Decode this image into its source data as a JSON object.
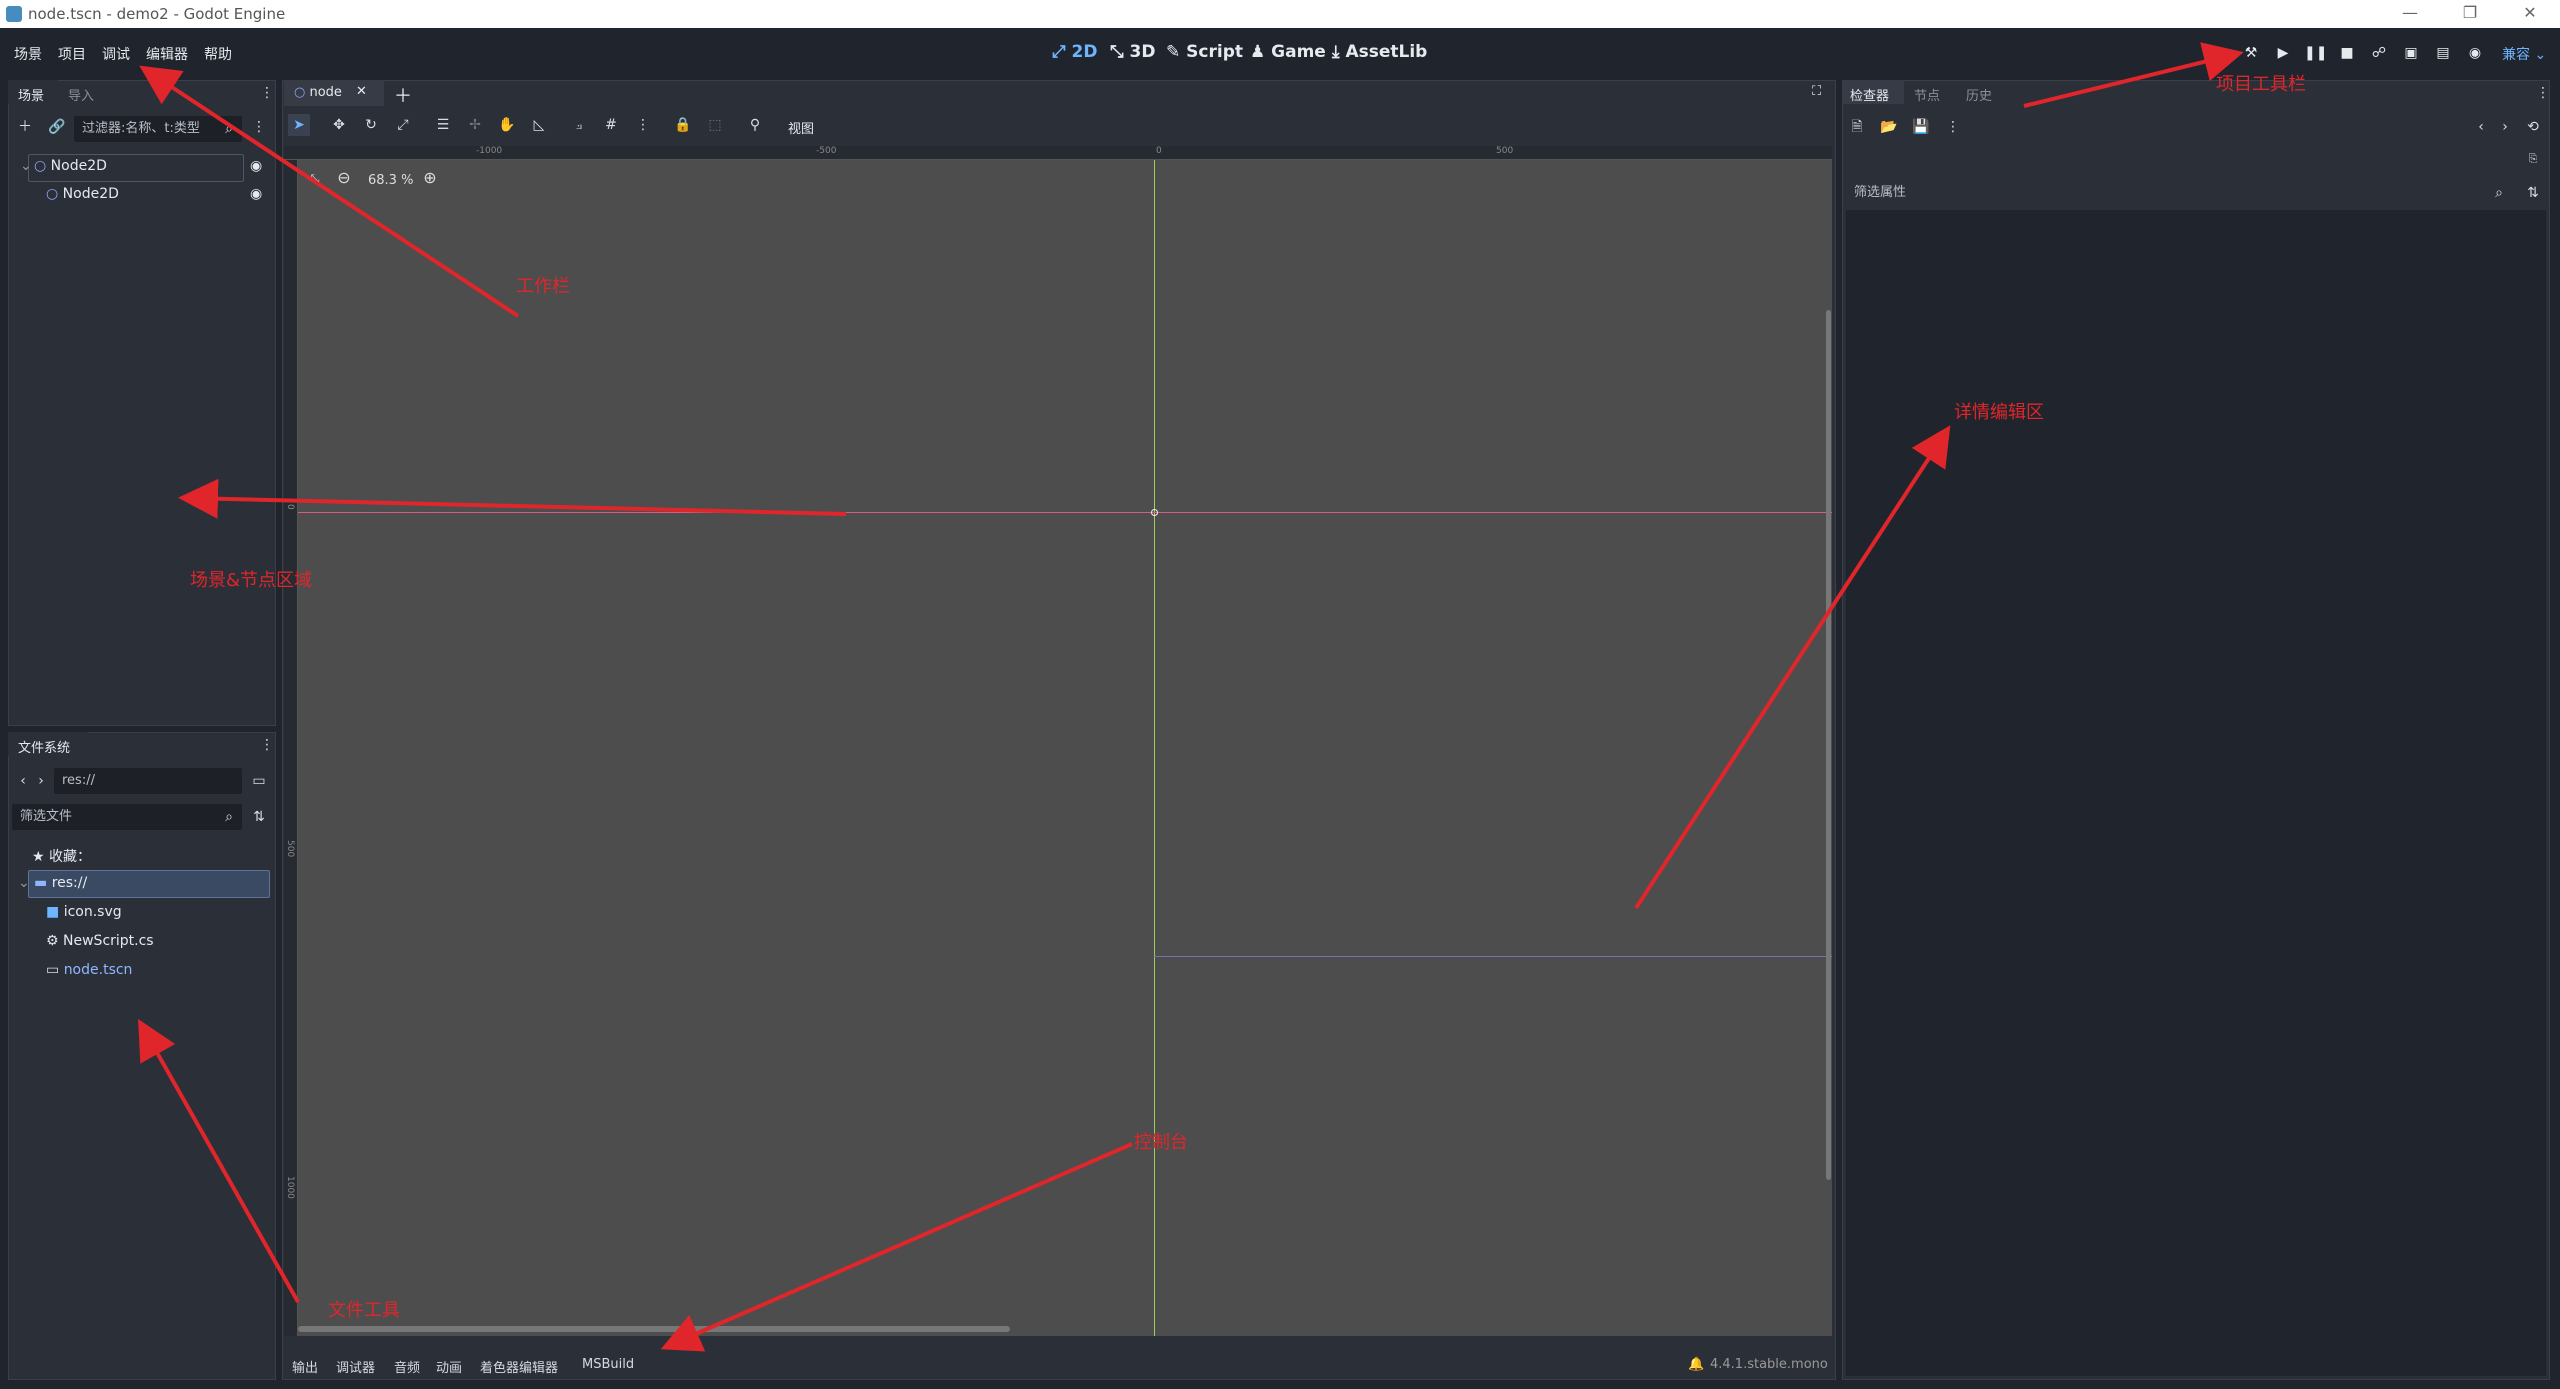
{
  "window": {
    "title": "node.tscn - demo2 - Godot Engine",
    "controls": [
      "—",
      "❐",
      "✕"
    ]
  },
  "menu": [
    "场景",
    "项目",
    "调试",
    "编辑器",
    "帮助"
  ],
  "modes": [
    {
      "label": "2D",
      "icon": "2d-mode-icon",
      "active": true
    },
    {
      "label": "3D",
      "icon": "3d-mode-icon",
      "active": false
    },
    {
      "label": "Script",
      "icon": "script-icon",
      "active": false
    },
    {
      "label": "Game",
      "icon": "game-icon",
      "active": false
    },
    {
      "label": "AssetLib",
      "icon": "assetlib-icon",
      "active": false
    }
  ],
  "renderer": "兼容",
  "scene_dock": {
    "tabs": [
      "场景",
      "导入"
    ],
    "filter_placeholder": "过滤器:名称、t:类型",
    "nodes": [
      {
        "name": "Node2D",
        "type": "root"
      },
      {
        "name": "Node2D",
        "type": "child"
      }
    ]
  },
  "filesystem_dock": {
    "tab": "文件系统",
    "path": "res://",
    "filter_placeholder": "筛选文件",
    "favorites_label": "收藏：",
    "root": "res://",
    "files": [
      {
        "name": "icon.svg",
        "icon": "image-icon"
      },
      {
        "name": "NewScript.cs",
        "icon": "csharp-script-icon"
      },
      {
        "name": "node.tscn",
        "icon": "scene-file-icon"
      }
    ]
  },
  "editor": {
    "scene_tab": "node",
    "view_menu": "视图",
    "zoom": "68.3 %",
    "ruler_ticks": [
      "-1000",
      "-500",
      "0",
      "500"
    ],
    "vruler_ticks": [
      "0",
      "500",
      "1000"
    ]
  },
  "inspector": {
    "tabs": [
      "检查器",
      "节点",
      "历史"
    ],
    "filter_placeholder": "筛选属性"
  },
  "bottom_panel": {
    "tabs": [
      "输出",
      "调试器",
      "音频",
      "动画",
      "着色器编辑器",
      "MSBuild"
    ],
    "version": "4.4.1.stable.mono"
  },
  "annotations": {
    "toolbar": "工作栏",
    "project_toolbar": "项目工具栏",
    "scene_node_area": "场景&节点区域",
    "detail_edit_area": "详情编辑区",
    "console": "控制台",
    "file_tools": "文件工具"
  },
  "colors": {
    "accent": "#6eb4ff",
    "annotation": "#e0262b",
    "viewport": "#4d4d4d",
    "y_axis": "#9bd15a",
    "x_axis": "#d65b8a"
  }
}
